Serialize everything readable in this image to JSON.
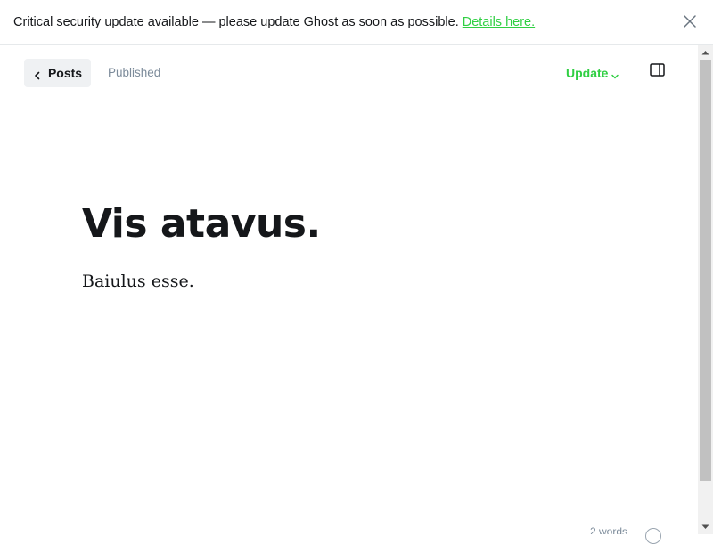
{
  "banner": {
    "message": "Critical security update available — please update Ghost as soon as possible.",
    "link_label": "Details here."
  },
  "toolbar": {
    "back_label": "Posts",
    "status": "Published",
    "update_label": "Update"
  },
  "post": {
    "title": "Vis atavus.",
    "body": "Baiulus esse."
  },
  "footer": {
    "word_count": "2 words"
  },
  "icons": {
    "close": "close-icon",
    "back": "chevron-left-icon",
    "update_caret": "chevron-down-icon",
    "sidebar": "sidebar-toggle-icon",
    "help": "help-icon"
  },
  "colors": {
    "accent_green": "#30cf43",
    "muted_text": "#7c8b9a",
    "back_button_bg": "#eff1f3",
    "text": "#15171a"
  }
}
